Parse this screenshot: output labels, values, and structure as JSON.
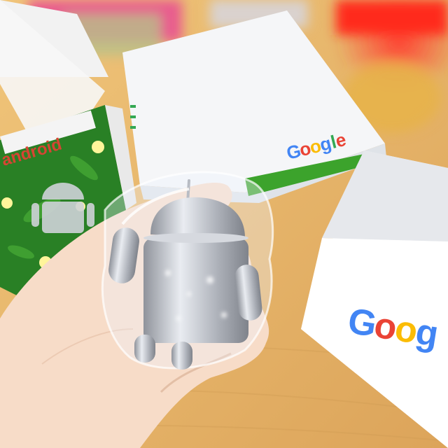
{
  "image": {
    "android_box": {
      "label": "android"
    },
    "google_box_back": {
      "wordmark": [
        "G",
        "o",
        "o",
        "g",
        "l",
        "e"
      ]
    },
    "google_box_front": {
      "wordmark": [
        "G",
        "o",
        "o",
        "g"
      ]
    }
  },
  "colors": {
    "google_blue": "#4285f4",
    "google_red": "#ea4335",
    "google_yellow": "#fbbc05",
    "google_green": "#34a853",
    "android_green": "#2f8a2a",
    "figurine_silver": "#c9ccd3",
    "table_wood": "#e8b86a"
  }
}
